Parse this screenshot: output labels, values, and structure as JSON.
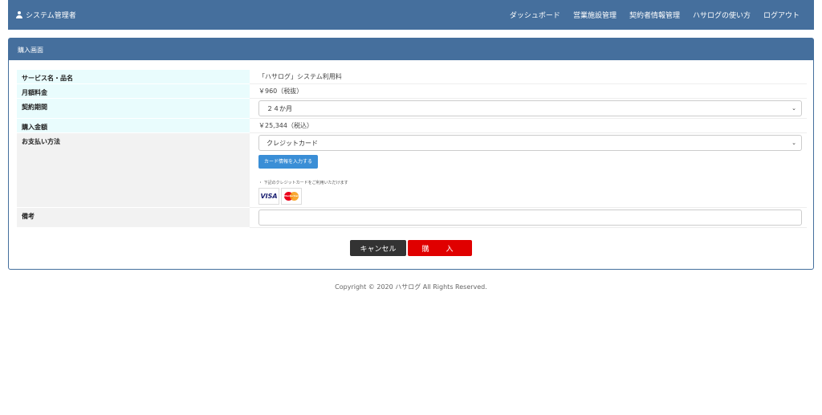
{
  "navbar": {
    "user_label": "システム管理者",
    "links": [
      "ダッシュボード",
      "営業施設管理",
      "契約者情報管理",
      "ハサログの使い方",
      "ログアウト"
    ]
  },
  "panel": {
    "title": "購入画面"
  },
  "form": {
    "service_label": "サービス名・品名",
    "service_value": "「ハサログ」システム利用料",
    "monthly_label": "月額料金",
    "monthly_value": "￥960（税抜）",
    "period_label": "契約期間",
    "period_value": "２４か月",
    "total_label": "購入金額",
    "total_value": "￥25,344（税込）",
    "payment_label": "お支払い方法",
    "payment_value": "クレジットカード",
    "card_button": "カード情報を入力する",
    "card_note": "・ 下記のクレジットカードをご利用いただけます",
    "visa_logo": "VISA",
    "mastercard_logo": "MasterCard",
    "remarks_label": "備考",
    "remarks_value": ""
  },
  "actions": {
    "cancel": "キャンセル",
    "buy": "購　入"
  },
  "footer": {
    "copyright": "Copyright © 2020 ハサログ All Rights Reserved."
  },
  "colors": {
    "header": "#456f9d",
    "label_bg": "#e9fcfd",
    "buy": "#e00000",
    "cancel": "#333333",
    "card_button": "#3a8ed6"
  }
}
